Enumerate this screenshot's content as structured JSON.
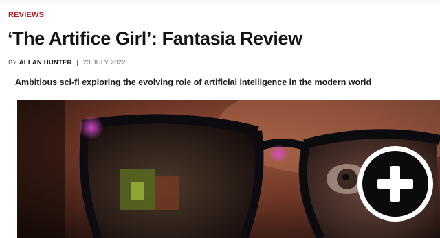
{
  "article": {
    "category": "REVIEWS",
    "title": "‘The Artifice Girl’: Fantasia Review",
    "byline": {
      "prefix": "BY",
      "author": "ALLAN HUNTER",
      "separator": "|",
      "date": "23 JULY 2022"
    },
    "standfirst": "Ambitious sci-fi exploring the evolving role of artificial intelligence in the modern world"
  },
  "hero": {
    "icon": "plus-icon",
    "colors": {
      "category": "#b3191d",
      "skin_warm": "#a8563a",
      "shadow": "#1a0f0c",
      "glasses_frame": "#0c0c10",
      "lens_reflection": "#6f8a2a"
    }
  }
}
